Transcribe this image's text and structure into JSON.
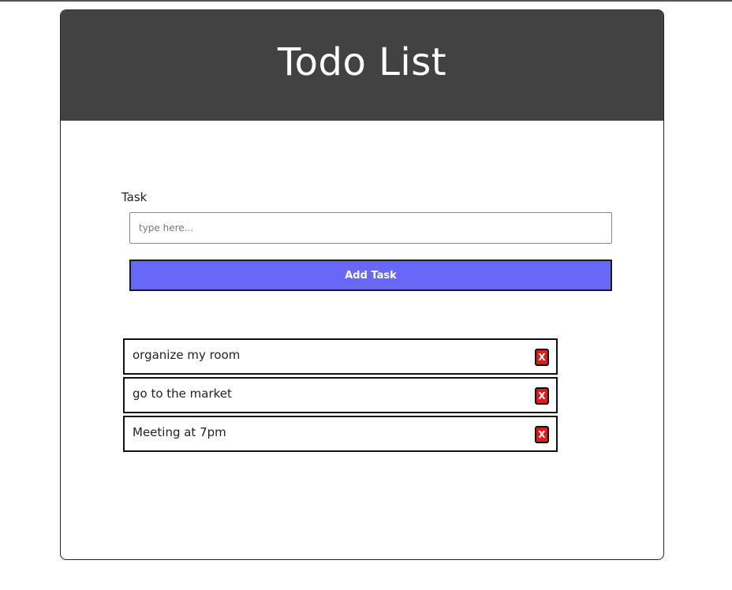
{
  "header": {
    "title": "Todo List"
  },
  "form": {
    "label": "Task",
    "input_placeholder": "type here...",
    "input_value": "",
    "add_button_label": "Add Task"
  },
  "tasks": [
    {
      "text": "organize my room",
      "delete_label": "X"
    },
    {
      "text": "go to the market",
      "delete_label": "X"
    },
    {
      "text": "Meeting at 7pm",
      "delete_label": "X"
    }
  ],
  "colors": {
    "header_bg": "#424242",
    "add_button_bg": "#6767f8",
    "delete_button_bg": "#e21a1a"
  }
}
